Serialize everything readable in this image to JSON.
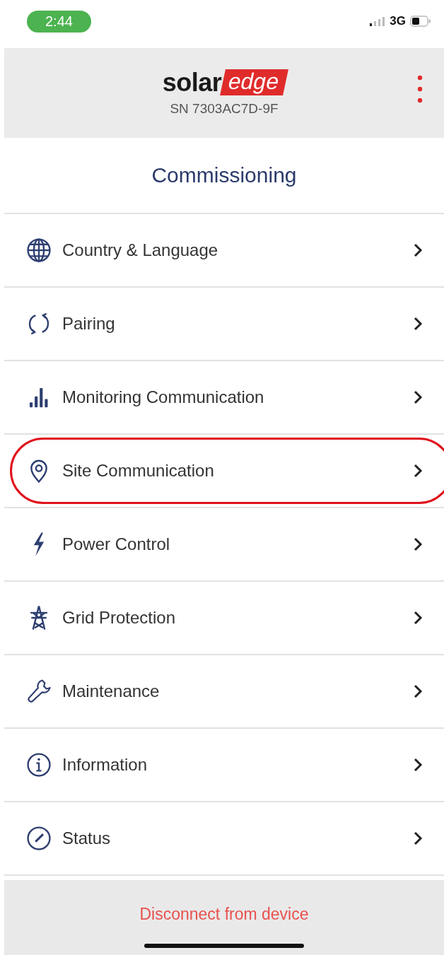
{
  "status_bar": {
    "time": "2:44",
    "network": "3G"
  },
  "header": {
    "logo": {
      "dark_part": "solar",
      "red_part": "edge"
    },
    "serial": "SN 7303AC7D-9F"
  },
  "title": "Commissioning",
  "menu": [
    {
      "kind": "globe",
      "label": "Country & Language",
      "highlighted": false
    },
    {
      "kind": "sync",
      "label": "Pairing",
      "highlighted": false
    },
    {
      "kind": "bars",
      "label": "Monitoring Communication",
      "highlighted": false
    },
    {
      "kind": "pin",
      "label": "Site Communication",
      "highlighted": true
    },
    {
      "kind": "bolt",
      "label": "Power Control",
      "highlighted": false
    },
    {
      "kind": "pylon",
      "label": "Grid Protection",
      "highlighted": false
    },
    {
      "kind": "wrench",
      "label": "Maintenance",
      "highlighted": false
    },
    {
      "kind": "info",
      "label": "Information",
      "highlighted": false
    },
    {
      "kind": "gauge",
      "label": "Status",
      "highlighted": false
    }
  ],
  "footer": {
    "action": "Disconnect from device"
  }
}
